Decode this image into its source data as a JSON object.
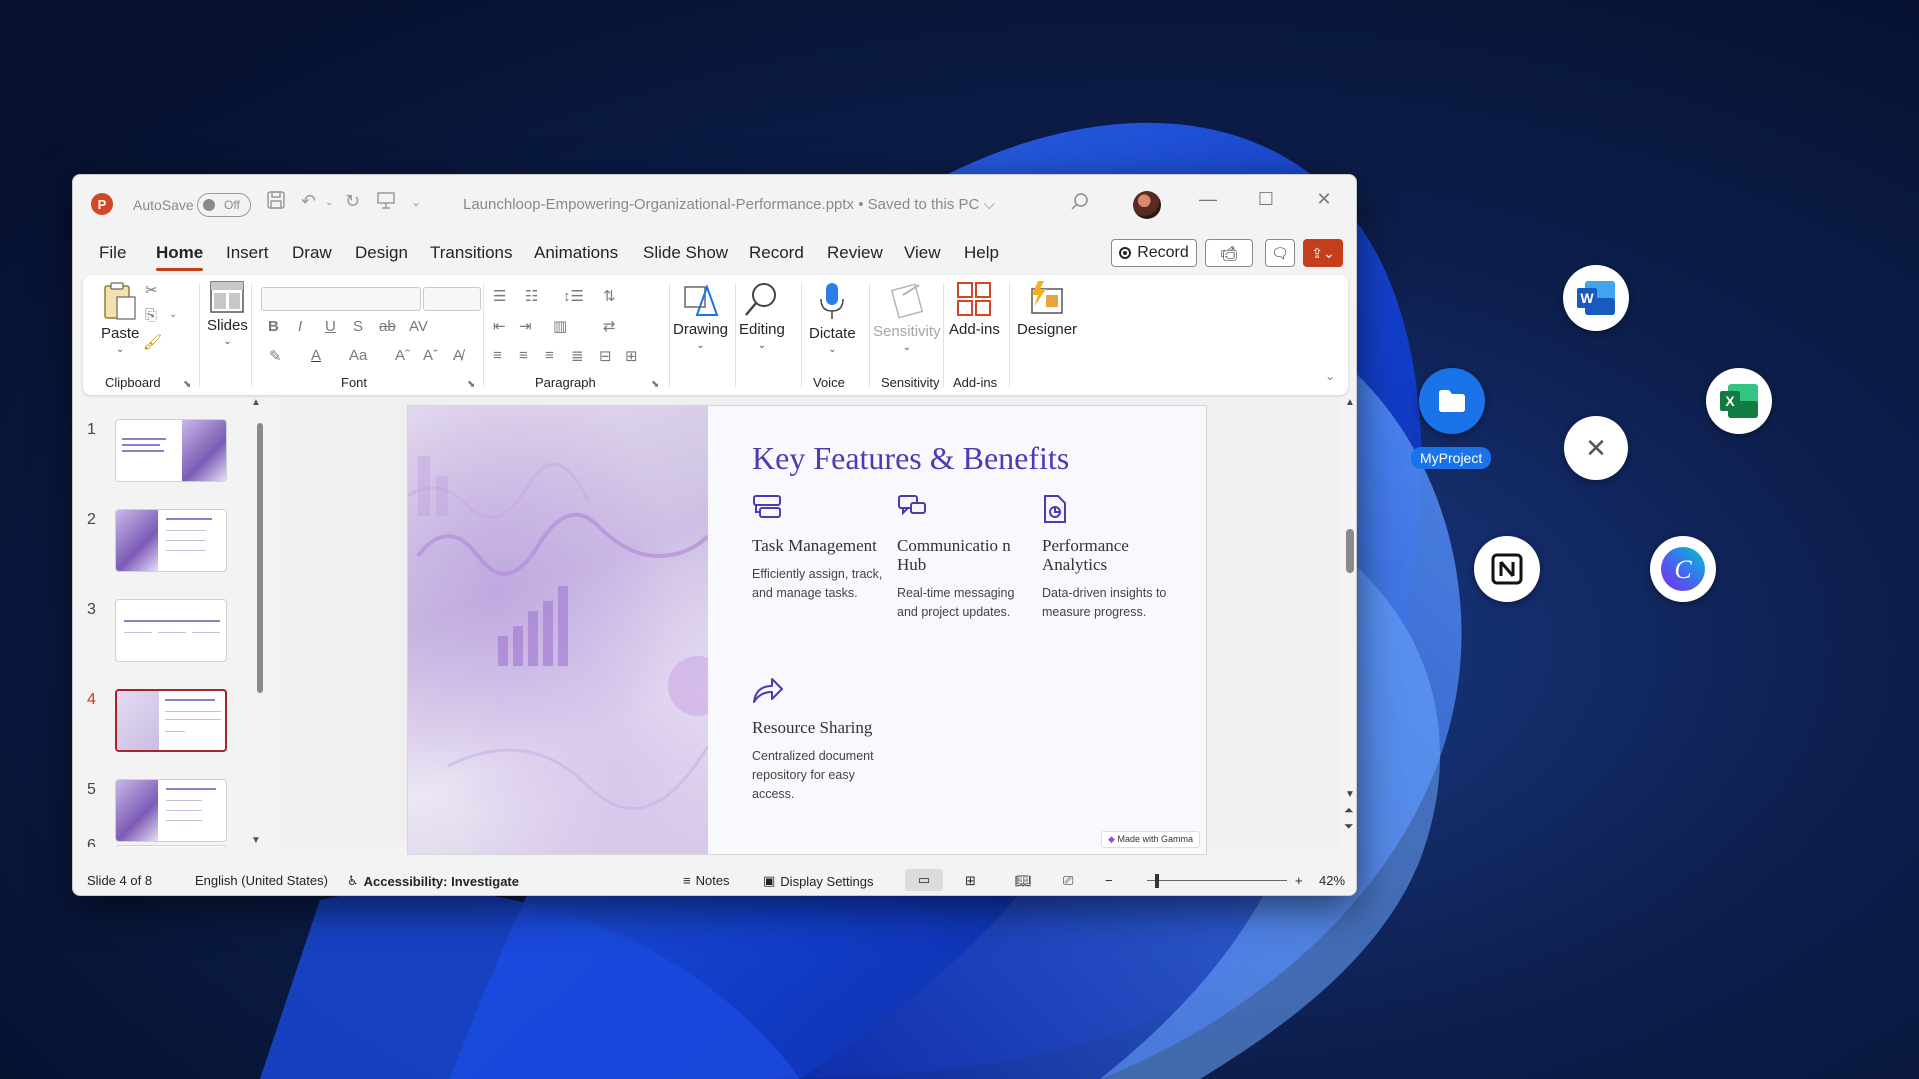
{
  "window": {
    "autosave_label": "AutoSave",
    "autosave_state": "Off",
    "doc_title": "Launchloop-Empowering-Organizational-Performance.pptx • Saved to this PC ⌵"
  },
  "tabs": [
    "File",
    "Home",
    "Insert",
    "Draw",
    "Design",
    "Transitions",
    "Animations",
    "Slide Show",
    "Record",
    "Review",
    "View",
    "Help"
  ],
  "record_button": "Record",
  "ribbon": {
    "paste": "Paste",
    "clipboard": "Clipboard",
    "slides": "Slides",
    "font": "Font",
    "paragraph": "Paragraph",
    "drawing": "Drawing",
    "editing": "Editing",
    "dictate": "Dictate",
    "voice": "Voice",
    "sensitivity_btn": "Sensitivity",
    "sensitivity": "Sensitivity",
    "addins_btn": "Add-ins",
    "addins": "Add-ins",
    "designer": "Designer",
    "font_icons": {
      "bold": "B",
      "italic": "I",
      "underline": "U",
      "shadow": "S",
      "strike": "ab",
      "spacing": "AV",
      "case": "Aa",
      "grow": "Aˆ",
      "shrink": "Aˇ"
    }
  },
  "thumbnails": [
    {
      "num": "1"
    },
    {
      "num": "2"
    },
    {
      "num": "3"
    },
    {
      "num": "4"
    },
    {
      "num": "5"
    },
    {
      "num": "6"
    }
  ],
  "slide": {
    "title": "Key Features & Benefits",
    "features": [
      {
        "icon": "task-icon",
        "title": "Task Management",
        "desc": "Efficiently assign, track, and manage tasks."
      },
      {
        "icon": "chat-icon",
        "title": "Communicatio n Hub",
        "desc": "Real-time messaging and project updates."
      },
      {
        "icon": "analytics-icon",
        "title": "Performance Analytics",
        "desc": "Data-driven insights to measure progress."
      },
      {
        "icon": "share-icon",
        "title": "Resource Sharing",
        "desc": "Centralized document repository for easy access."
      }
    ],
    "badge": "Made with Gamma"
  },
  "status": {
    "slide": "Slide 4 of 8",
    "language": "English (United States)",
    "accessibility": "Accessibility: Investigate",
    "notes": "Notes",
    "display": "Display Settings",
    "zoom": "42%"
  },
  "desktop": {
    "myproject": "MyProject",
    "colors": {
      "accent": "#1a73e8",
      "ppt": "#c43e1c"
    }
  }
}
